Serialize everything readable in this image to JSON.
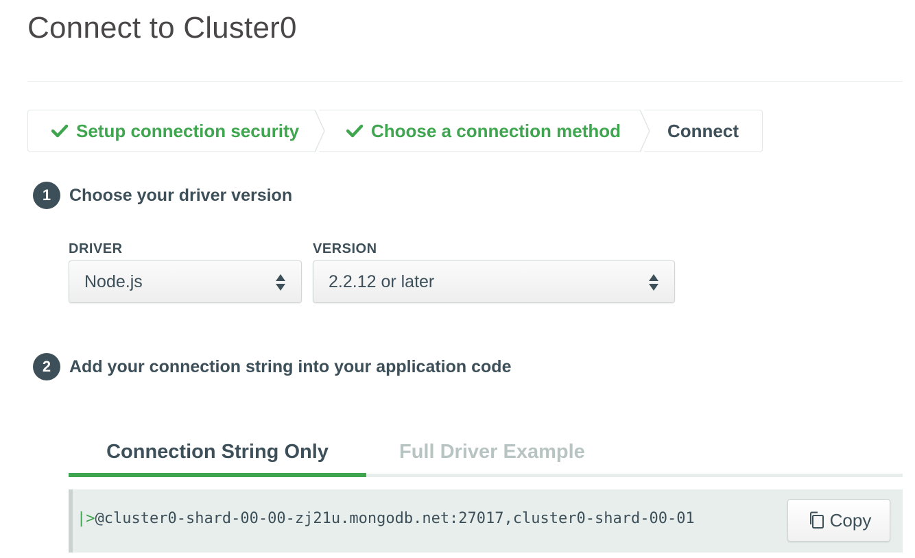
{
  "page_title": "Connect to Cluster0",
  "breadcrumb": {
    "steps": [
      {
        "label": "Setup connection security",
        "status": "done"
      },
      {
        "label": "Choose a connection method",
        "status": "done"
      },
      {
        "label": "Connect",
        "status": "current"
      }
    ]
  },
  "step1": {
    "number": "1",
    "title": "Choose your driver version",
    "driver_label": "DRIVER",
    "driver_value": "Node.js",
    "version_label": "VERSION",
    "version_value": "2.2.12 or later"
  },
  "step2": {
    "number": "2",
    "title": "Add your connection string into your application code"
  },
  "tabs": [
    {
      "label": "Connection String Only",
      "active": true
    },
    {
      "label": "Full Driver Example",
      "active": false
    }
  ],
  "code": {
    "prefix": "|>",
    "text": "@cluster0-shard-00-00-zj21u.mongodb.net:27017,cluster0-shard-00-01"
  },
  "copy_button": {
    "label": "Copy",
    "icon": "copy-icon"
  },
  "colors": {
    "accent_green": "#3fa54f",
    "text_dark": "#3d4f58",
    "tab_inactive": "#b8c4c2",
    "code_bg": "#e7eeec"
  }
}
